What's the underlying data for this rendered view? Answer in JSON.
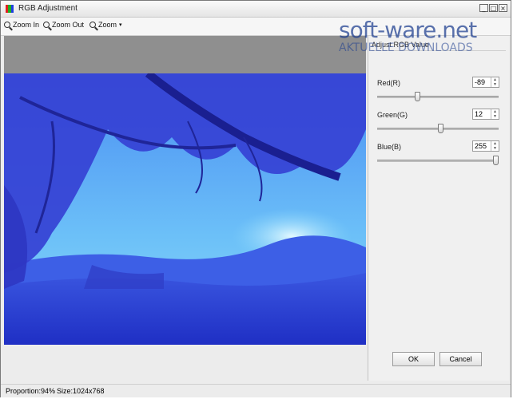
{
  "window": {
    "title": "RGB Adjustment",
    "controls": [
      "_",
      "□",
      "×"
    ]
  },
  "toolbar": {
    "zoom_in": "Zoom In",
    "zoom_out": "Zoom Out",
    "zoom": "Zoom",
    "zoom_caret": "▾"
  },
  "panel": {
    "group_title": "Adjust RGB Value",
    "red": {
      "label": "Red(R)",
      "value": "-89",
      "range": [
        -255,
        255
      ]
    },
    "green": {
      "label": "Green(G)",
      "value": "12",
      "range": [
        -255,
        255
      ]
    },
    "blue": {
      "label": "Blue(B)",
      "value": "255",
      "range": [
        -255,
        255
      ]
    }
  },
  "buttons": {
    "ok": "OK",
    "cancel": "Cancel"
  },
  "status": {
    "proportion": "Proportion:94%",
    "size": "Size:1024x768"
  },
  "watermark": {
    "main": "soft-ware.net",
    "sub": "AKTUELLE DOWNLOADS"
  },
  "colors": {
    "sky": "#5ea8f5",
    "foliage": "#3b45d6",
    "ground": "#2a3fd0",
    "watermark": "#1c3d8f"
  }
}
